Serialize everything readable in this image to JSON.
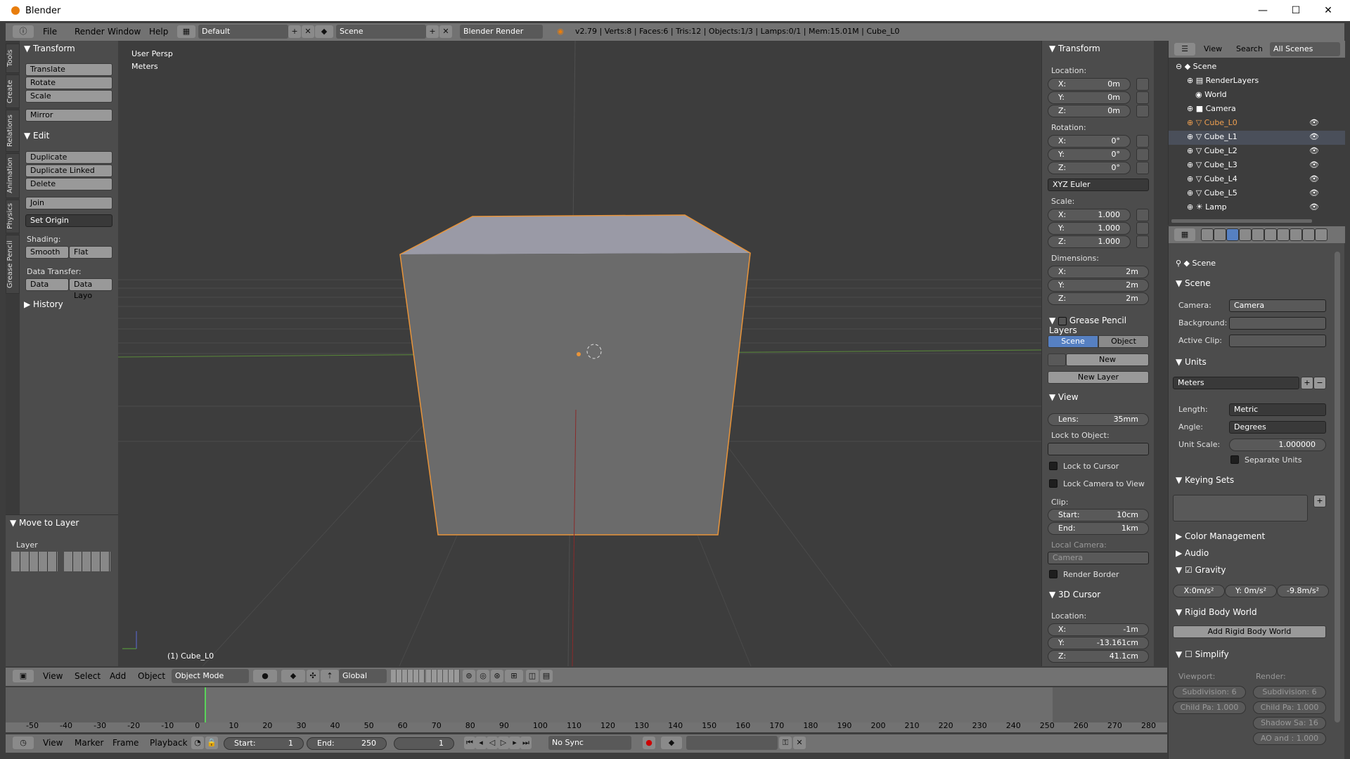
{
  "window": {
    "title": "Blender"
  },
  "menubar": {
    "items": [
      "File",
      "Render",
      "Window",
      "Help"
    ],
    "layout": "Default",
    "scene": "Scene",
    "engine": "Blender Render",
    "stats": "v2.79 | Verts:8 | Faces:6 | Tris:12 | Objects:1/3 | Lamps:0/1 | Mem:15.01M | Cube_L0"
  },
  "vtabs": [
    "Tools",
    "Create",
    "Relations",
    "Animation",
    "Physics",
    "Grease Pencil"
  ],
  "toolshelf": {
    "transform": "Transform",
    "translate": "Translate",
    "rotate": "Rotate",
    "scale": "Scale",
    "mirror": "Mirror",
    "edit": "Edit",
    "duplicate": "Duplicate",
    "duplicate_linked": "Duplicate Linked",
    "delete": "Delete",
    "join": "Join",
    "set_origin": "Set Origin",
    "shading": "Shading:",
    "smooth": "Smooth",
    "flat": "Flat",
    "data_transfer": "Data Transfer:",
    "data": "Data",
    "data_layo": "Data Layo",
    "history": "History",
    "move_to_layer": "Move to Layer",
    "layer": "Layer"
  },
  "viewport": {
    "persp": "User Persp",
    "units": "Meters",
    "object_label": "(1) Cube_L0",
    "header": {
      "view": "View",
      "select": "Select",
      "add": "Add",
      "object": "Object",
      "mode": "Object Mode",
      "orientation": "Global"
    }
  },
  "npanel": {
    "transform": "Transform",
    "location": "Location:",
    "loc": [
      {
        "a": "X:",
        "v": "0m"
      },
      {
        "a": "Y:",
        "v": "0m"
      },
      {
        "a": "Z:",
        "v": "0m"
      }
    ],
    "rotation": "Rotation:",
    "rot": [
      {
        "a": "X:",
        "v": "0°"
      },
      {
        "a": "Y:",
        "v": "0°"
      },
      {
        "a": "Z:",
        "v": "0°"
      }
    ],
    "euler": "XYZ Euler",
    "scale": "Scale:",
    "scl": [
      {
        "a": "X:",
        "v": "1.000"
      },
      {
        "a": "Y:",
        "v": "1.000"
      },
      {
        "a": "Z:",
        "v": "1.000"
      }
    ],
    "dimensions": "Dimensions:",
    "dim": [
      {
        "a": "X:",
        "v": "2m"
      },
      {
        "a": "Y:",
        "v": "2m"
      },
      {
        "a": "Z:",
        "v": "2m"
      }
    ],
    "gp_layers": "Grease Pencil Layers",
    "scene_tab": "Scene",
    "object_tab": "Object",
    "new": "New",
    "new_layer": "New Layer",
    "view": "View",
    "lens_l": "Lens:",
    "lens_v": "35mm",
    "lock_obj": "Lock to Object:",
    "lock_cursor": "Lock to Cursor",
    "lock_cam": "Lock Camera to View",
    "clip": "Clip:",
    "clip_start_l": "Start:",
    "clip_start_v": "10cm",
    "clip_end_l": "End:",
    "clip_end_v": "1km",
    "local_camera": "Local Camera:",
    "camera": "Camera",
    "render_border": "Render Border",
    "cursor": "3D Cursor",
    "cursor_loc": "Location:",
    "cur": [
      {
        "a": "X:",
        "v": "-1m"
      },
      {
        "a": "Y:",
        "v": "-13.161cm"
      },
      {
        "a": "Z:",
        "v": "41.1cm"
      }
    ]
  },
  "outliner": {
    "view": "View",
    "search": "Search",
    "all_scenes": "All Scenes",
    "items": [
      "Scene",
      "RenderLayers",
      "World",
      "Camera",
      "Cube_L0",
      "Cube_L1",
      "Cube_L2",
      "Cube_L3",
      "Cube_L4",
      "Cube_L5",
      "Lamp"
    ]
  },
  "properties": {
    "scene": "Scene",
    "scene_section": "Scene",
    "camera_l": "Camera:",
    "camera_v": "Camera",
    "background": "Background:",
    "active_clip": "Active Clip:",
    "units": "Units",
    "unit_preset": "Meters",
    "length_l": "Length:",
    "length_v": "Metric",
    "angle_l": "Angle:",
    "angle_v": "Degrees",
    "unit_scale_l": "Unit Scale:",
    "unit_scale_v": "1.000000",
    "separate_units": "Separate Units",
    "keying_sets": "Keying Sets",
    "color_mgmt": "Color Management",
    "audio": "Audio",
    "gravity": "Gravity",
    "gx": "X:0m/s²",
    "gy": "Y: 0m/s²",
    "gz": "-9.8m/s²",
    "rigid_body": "Rigid Body World",
    "add_rigid": "Add Rigid Body World",
    "simplify": "Simplify",
    "viewport": "Viewport:",
    "render": "Render:",
    "subdiv_v": "Subdivision: 6",
    "subdiv_r": "Subdivision: 6",
    "child_v": "Child Pa: 1.000",
    "child_r": "Child Pa: 1.000",
    "shadow": "Shadow Sa: 16",
    "ao": "AO and : 1.000"
  },
  "timeline": {
    "ticks": [
      "-50",
      "-40",
      "-30",
      "-20",
      "-10",
      "0",
      "10",
      "20",
      "30",
      "40",
      "50",
      "60",
      "70",
      "80",
      "90",
      "100",
      "110",
      "120",
      "130",
      "140",
      "150",
      "160",
      "170",
      "180",
      "190",
      "200",
      "210",
      "220",
      "230",
      "240",
      "250",
      "260",
      "270",
      "280"
    ],
    "view": "View",
    "marker": "Marker",
    "frame": "Frame",
    "playback": "Playback",
    "start_l": "Start:",
    "start_v": "1",
    "end_l": "End:",
    "end_v": "250",
    "current": "1",
    "sync": "No Sync"
  }
}
